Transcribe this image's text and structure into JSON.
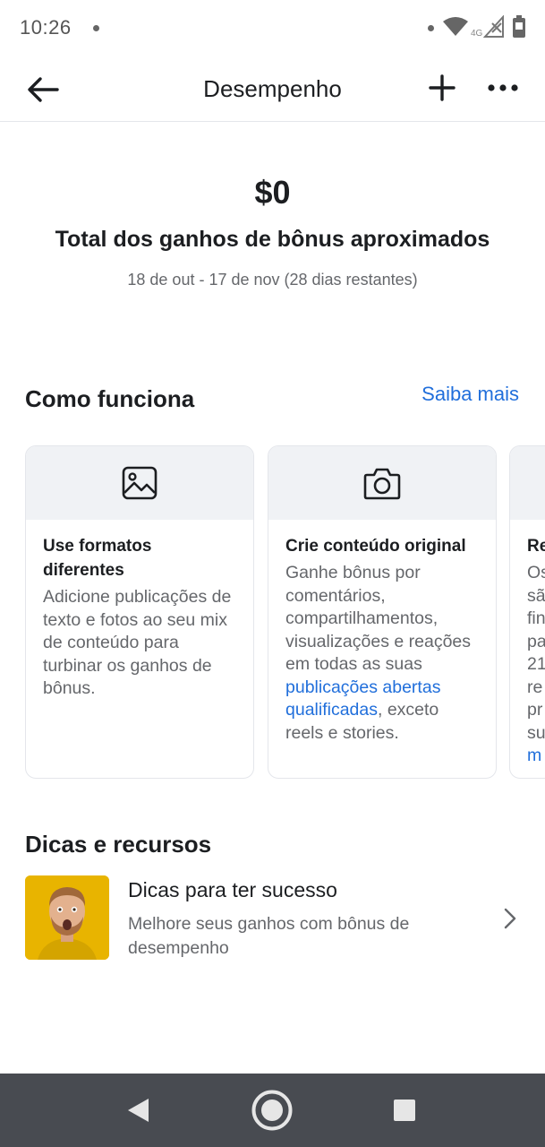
{
  "status_bar": {
    "time": "10:26",
    "network": "4G"
  },
  "app_bar": {
    "title": "Desempenho"
  },
  "summary": {
    "amount": "$0",
    "label": "Total dos ganhos de bônus aproximados",
    "date_range": "18 de out - 17 de nov (28 dias restantes)"
  },
  "how_it_works": {
    "title": "Como funciona",
    "learn_more": "Saiba mais",
    "cards": [
      {
        "icon": "image-icon",
        "title": "Use formatos diferentes",
        "text": "Adicione publicações de texto e fotos ao seu mix de conteúdo para turbinar os ganhos de bônus."
      },
      {
        "icon": "camera-icon",
        "title": "Crie conteúdo original",
        "text_before": "Ganhe bônus por comentários, compartilhamentos, visualizações e reações em todas as suas ",
        "link": "publicações abertas qualificadas",
        "text_after": ", exceto reels e stories."
      },
      {
        "title_partial": "Re",
        "text_partial": [
          "Os",
          "sã",
          "fin",
          "pa",
          "21",
          "re",
          "pr",
          "su"
        ],
        "link_partial": "m"
      }
    ]
  },
  "tips": {
    "title": "Dicas e recursos",
    "item_title": "Dicas para ter sucesso",
    "item_subtitle": "Melhore seus ganhos com bônus de desempenho"
  },
  "colors": {
    "link": "#216fdb",
    "nav_bar": "#484b51",
    "card_head": "#f0f2f5",
    "thumb_bg": "#e8b400"
  }
}
